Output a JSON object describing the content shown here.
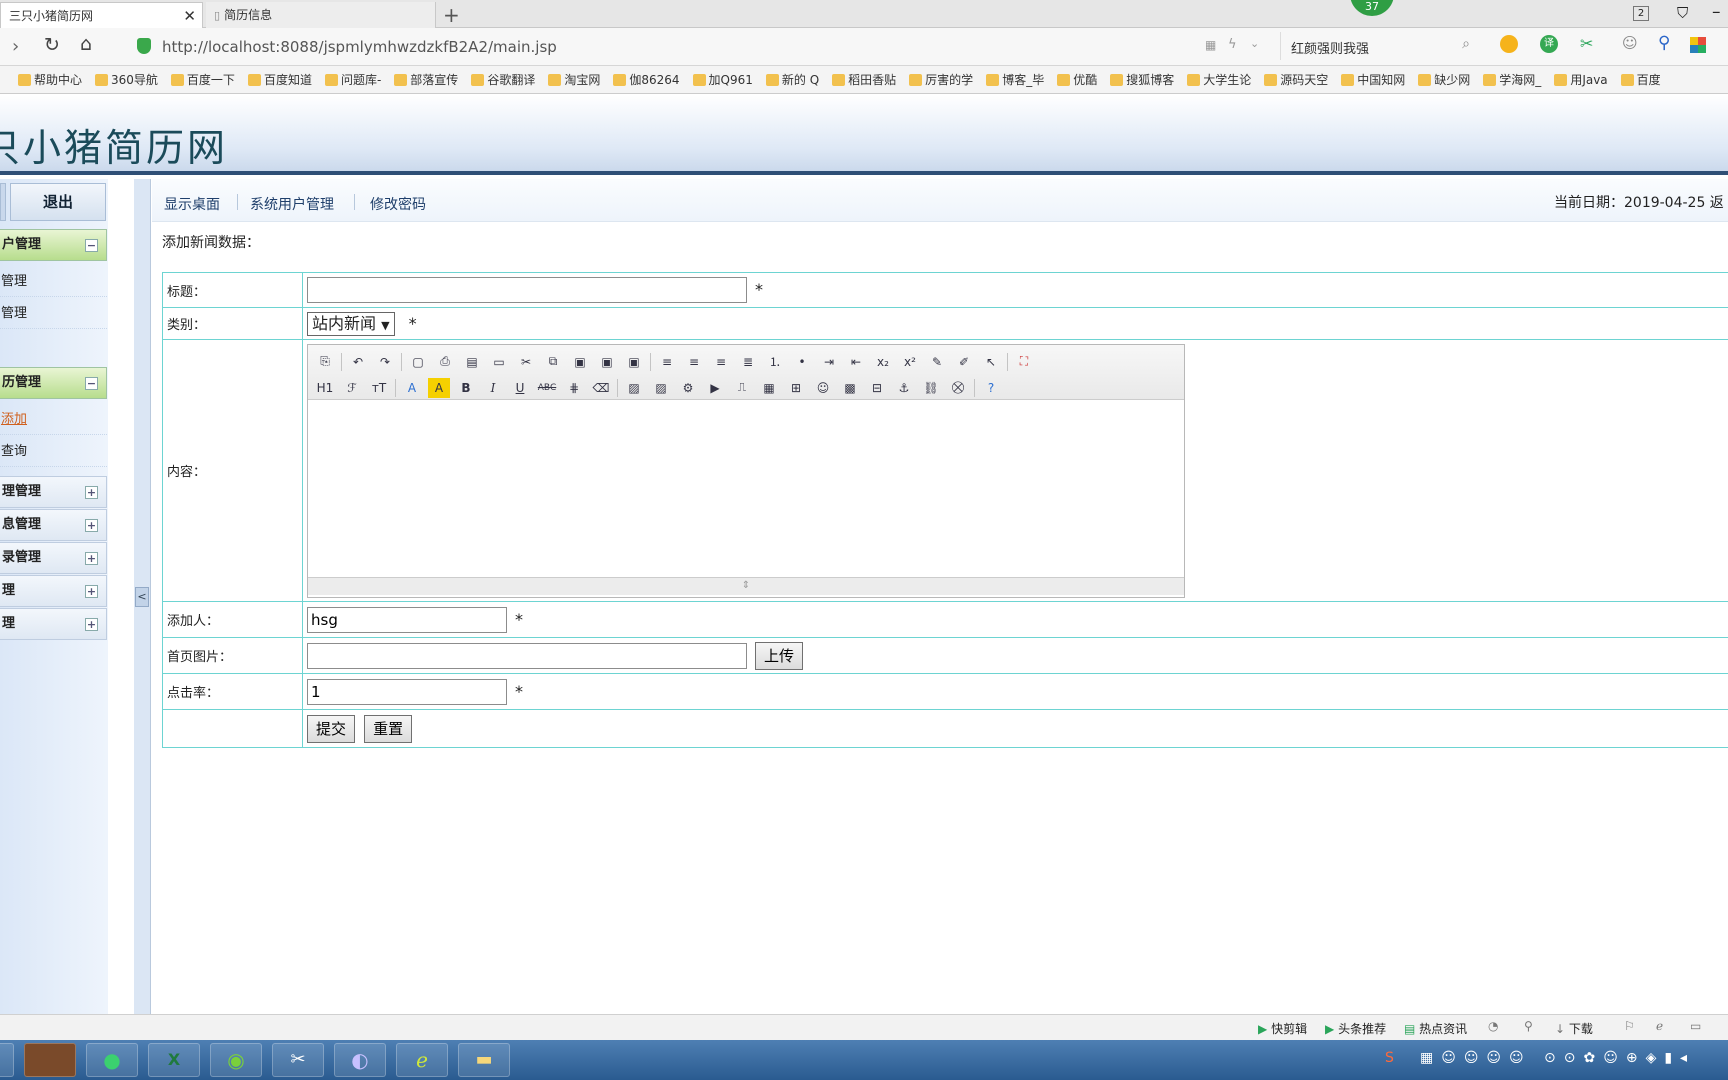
{
  "browser": {
    "tabs": [
      {
        "label": "三只小猪简历网"
      },
      {
        "label": "简历信息"
      }
    ],
    "new_tab_symbol": "+",
    "badge_count": "37",
    "window_count": "2",
    "url": "http://localhost:8088/jspmlymhwzdzkfB2A2/main.jsp",
    "search_text": "红颜强则我强",
    "bookmarks": [
      "帮助中心",
      "360导航",
      "百度一下",
      "百度知道",
      "问题库-",
      "部落宣传",
      "谷歌翻译",
      "淘宝网",
      "伽86264",
      "加Q961",
      "新的 Q",
      "稻田香贴",
      "厉害的学",
      "博客_毕",
      "优酷",
      "搜狐博客",
      "大学生论",
      "源码天空",
      "中国知网",
      "缺少网",
      "学海网_",
      "用Java",
      "百度"
    ]
  },
  "site": {
    "title": "只小猪简历网"
  },
  "sidebar": {
    "logout": "退出",
    "groups": [
      {
        "label": "户管理",
        "toggle": "−",
        "items": [
          "管理",
          "管理"
        ]
      },
      {
        "label": "历管理",
        "toggle": "−",
        "items": [
          "添加",
          "查询"
        ]
      },
      {
        "label": "理管理",
        "toggle": "+"
      },
      {
        "label": "息管理",
        "toggle": "+"
      },
      {
        "label": "录管理",
        "toggle": "+"
      },
      {
        "label": "理",
        "toggle": "+"
      },
      {
        "label": "理",
        "toggle": "+"
      }
    ],
    "collapse_arrow": "<"
  },
  "topnav": {
    "links": [
      "显示桌面",
      "系统用户管理",
      "修改密码"
    ],
    "date_text": "当前日期：2019-04-25 返"
  },
  "form": {
    "heading": "添加新闻数据：",
    "labels": {
      "title": "标题：",
      "category": "类别：",
      "content": "内容：",
      "author": "添加人：",
      "image": "首页图片：",
      "clicks": "点击率："
    },
    "values": {
      "title": "",
      "category": "站内新闻",
      "author": "hsg",
      "image": "",
      "clicks": "1"
    },
    "required_mark": "*",
    "upload_button": "上传",
    "submit_button": "提交",
    "reset_button": "重置"
  },
  "statusbar": {
    "items": [
      "快剪辑",
      "头条推荐",
      "热点资讯",
      "下载"
    ]
  }
}
